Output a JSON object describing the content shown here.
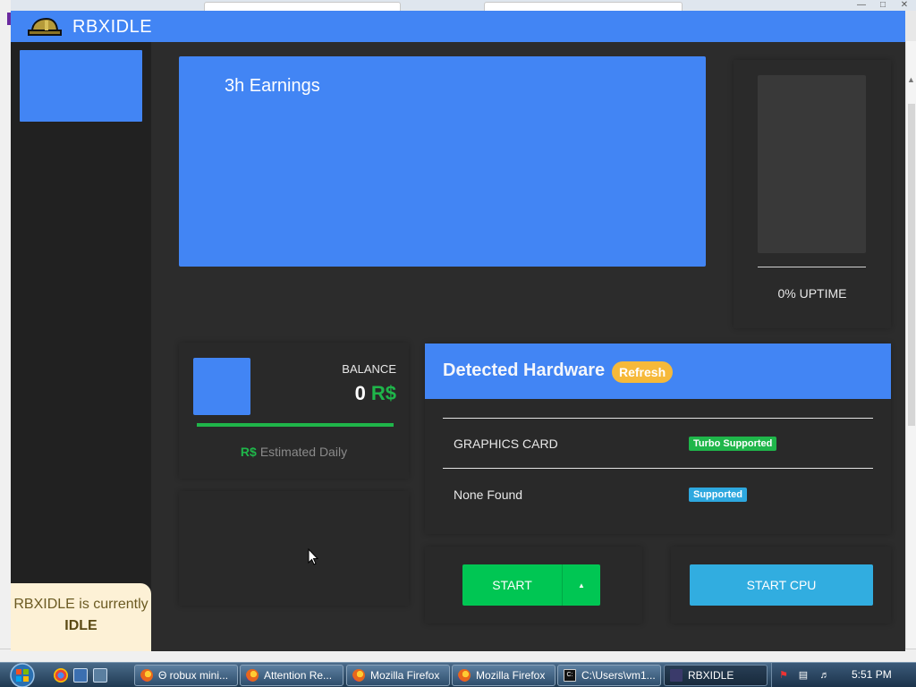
{
  "app": {
    "title": "RBXIDLE"
  },
  "sidebar": {
    "status_prefix": "RBXIDLE is currently",
    "status_value": "IDLE"
  },
  "earnings": {
    "title": "3h Earnings"
  },
  "uptime": {
    "label": "0% UPTIME",
    "percent": 0
  },
  "balance": {
    "label": "BALANCE",
    "value": "0",
    "currency": "R$",
    "estimated_label": "Estimated Daily",
    "estimated_currency": "R$",
    "progress_fraction": 1.0
  },
  "hardware": {
    "title": "Detected Hardware",
    "refresh_label": "Refresh",
    "rows": [
      {
        "label": "GRAPHICS CARD",
        "badge": "Turbo Supported"
      },
      {
        "label": "None Found",
        "badge": "Supported"
      }
    ]
  },
  "controls": {
    "start_label": "START",
    "start_cpu_label": "START CPU"
  },
  "taskbar": {
    "items": [
      {
        "label": "Θ robux mini...",
        "icon": "firefox-icon"
      },
      {
        "label": "Attention Re...",
        "icon": "firefox-icon"
      },
      {
        "label": "Mozilla Firefox",
        "icon": "firefox-icon"
      },
      {
        "label": "Mozilla Firefox",
        "icon": "firefox-icon"
      },
      {
        "label": "C:\\Users\\vm1...",
        "icon": "terminal-icon"
      },
      {
        "label": "RBXIDLE",
        "icon": "app-icon"
      }
    ],
    "clock": "5:51 PM"
  },
  "colors": {
    "accent": "#4285f4",
    "success": "#00c653",
    "info": "#31ade0",
    "warning": "#f6b93a",
    "panel": "#2c2c2c",
    "sidebar": "#212121"
  }
}
